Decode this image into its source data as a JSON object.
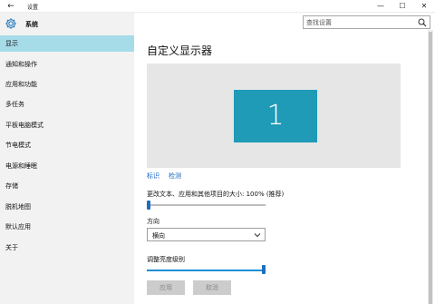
{
  "window": {
    "title": "设置",
    "back_glyph": "←",
    "minimize_glyph": "—",
    "maximize_glyph": "☐",
    "close_glyph": "✕"
  },
  "sidebar": {
    "title": "系统",
    "icon": "gear-icon",
    "items": [
      {
        "label": "显示",
        "selected": true
      },
      {
        "label": "通知和操作"
      },
      {
        "label": "应用和功能"
      },
      {
        "label": "多任务"
      },
      {
        "label": "平板电脑模式"
      },
      {
        "label": "节电模式"
      },
      {
        "label": "电源和睡眠"
      },
      {
        "label": "存储"
      },
      {
        "label": "脱机地图"
      },
      {
        "label": "默认应用"
      },
      {
        "label": "关于"
      }
    ]
  },
  "search": {
    "placeholder": "查找设置",
    "icon": "search-icon"
  },
  "main": {
    "title": "自定义显示器",
    "monitor_number": "1",
    "identify_link": "标识",
    "detect_link": "检测",
    "scale_label": "更改文本、应用和其他项目的大小: 100% (推荐)",
    "scale_value": 0.0,
    "orientation_label": "方向",
    "orientation_value": "横向",
    "brightness_label": "调整亮度级别",
    "brightness_value": 1.0,
    "apply_button": "应用",
    "cancel_button": "取消"
  },
  "colors": {
    "accent": "#1e8fd5",
    "selected_item": "#a6dbe8",
    "monitor_tile": "#1f9ab7"
  }
}
